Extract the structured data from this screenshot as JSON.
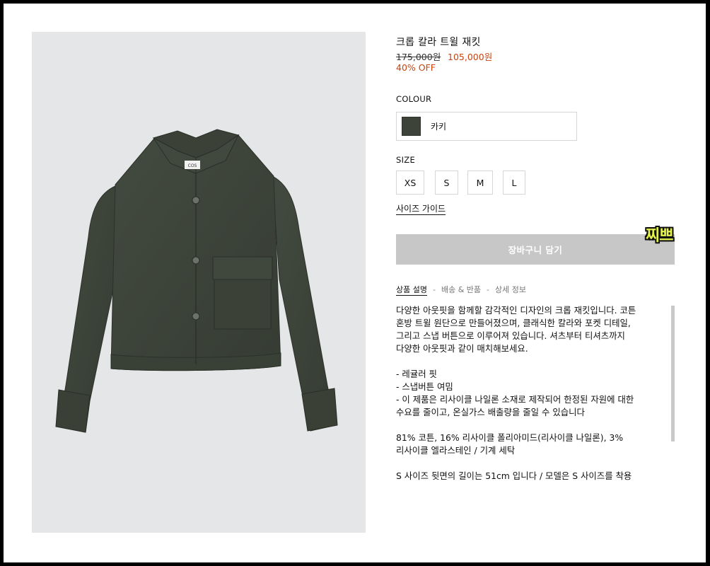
{
  "product": {
    "title": "크롭 칼라 트윌 재킷",
    "price_original": "175,000원",
    "price_sale": "105,000원",
    "discount": "40% OFF",
    "brand_tag": "COS"
  },
  "colour": {
    "label": "COLOUR",
    "selected_name": "카키",
    "selected_hex": "#3d4338"
  },
  "size": {
    "label": "SIZE",
    "options": [
      "XS",
      "S",
      "M",
      "L"
    ],
    "guide_label": "사이즈 가이드"
  },
  "cart": {
    "button_label": "장바구니 담기"
  },
  "sticker_text": "찌쁘",
  "tabs": [
    {
      "label": "상품 설명",
      "active": true
    },
    {
      "label": "배송 & 반품",
      "active": false
    },
    {
      "label": "상세 정보",
      "active": false
    }
  ],
  "description": {
    "intro": [
      "다양한 아웃핏을 함께할 감각적인 디자인의 크롭 재킷입니다. 코튼",
      "혼방 트윌 원단으로 만들어졌으며, 클래식한 칼라와 포켓 디테일,",
      "그리고 스냅 버튼으로 이루어져 있습니다. 셔츠부터 티셔츠까지",
      "다양한 아웃핏과 같이 매치해보세요."
    ],
    "features": [
      "- 레귤러 핏",
      "- 스냅버튼 여밈",
      "- 이 제품은 리사이클 나일론 소재로 제작되어 한정된 자원에 대한",
      "수요를 줄이고, 온실가스 배출량을 줄일 수 있습니다"
    ],
    "composition": [
      "81% 코튼, 16% 리사이클 폴리아미드(리사이클 나일론), 3%",
      "리사이클 엘라스테인 / 기계 세탁"
    ],
    "fit_note": "S 사이즈 뒷면의 길이는 51cm 입니다 / 모델은 S 사이즈를 착용"
  },
  "colors": {
    "sale_red": "#c8430f",
    "jacket": "#3d4338",
    "cart_disabled": "#c7c7c7",
    "image_bg": "#e5e6e8"
  }
}
